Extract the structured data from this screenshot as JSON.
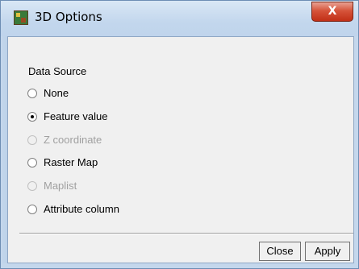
{
  "window": {
    "title": "3D Options",
    "close_label": "X"
  },
  "data_source": {
    "label": "Data Source",
    "options": [
      {
        "label": "None",
        "checked": false,
        "enabled": true
      },
      {
        "label": "Feature value",
        "checked": true,
        "enabled": true
      },
      {
        "label": "Z coordinate",
        "checked": false,
        "enabled": false
      },
      {
        "label": "Raster Map",
        "checked": false,
        "enabled": true
      },
      {
        "label": "Maplist",
        "checked": false,
        "enabled": false
      },
      {
        "label": "Attribute column",
        "checked": false,
        "enabled": true
      }
    ]
  },
  "footer": {
    "close_label": "Close",
    "apply_label": "Apply"
  }
}
